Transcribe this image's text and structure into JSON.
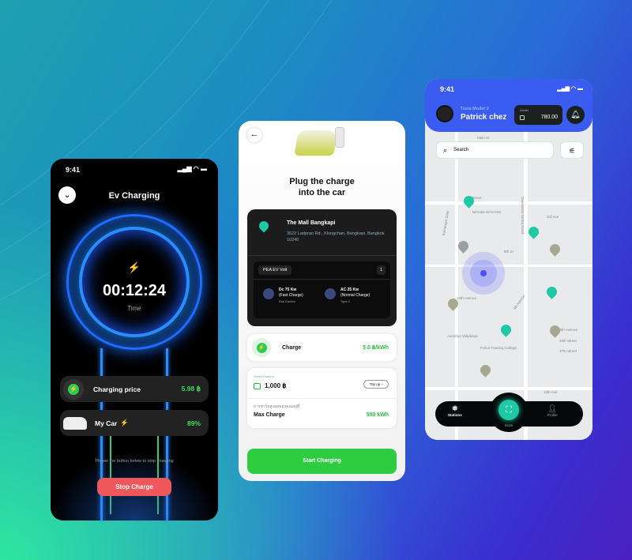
{
  "screen1": {
    "time": "9:41",
    "title": "Ev Charging",
    "timer": "00:12:24",
    "timer_label": "Time",
    "price_label": "Charging price",
    "price_value": "5.98 ฿",
    "car_label": "My Car",
    "car_value": "89%",
    "hint": "Please the button below to stop charging",
    "stop_button": "Stop Charge"
  },
  "screen2": {
    "title_line1": "Plug the charge",
    "title_line2": "into the car",
    "station": {
      "name": "The Mall Bangkapi",
      "address": "3522 Ladprao Rd., Klongchan, Bangkapi, Bangkok 10240",
      "provider": "PEA EV Volt",
      "count": "1",
      "connectors": [
        {
          "title": "Dc 75 Kw",
          "subtitle": "(Fast Charge)",
          "type": "Css Combo"
        },
        {
          "title": "AC 25 Kw",
          "subtitle": "(Normal Charge)",
          "type": "Type 2"
        }
      ]
    },
    "charge_label": "Charge",
    "charge_value": "5.0 ฿/kWh",
    "wallet_label": "Wallet Balance",
    "wallet_value": "1,000 ฿",
    "topup": "Top up",
    "max_thai": "การชาร์จสูงสุดของคุณอยู่ที่",
    "max_label": "Max Charge",
    "max_value": "500 kWh",
    "start_button": "Start Charging"
  },
  "screen3": {
    "time": "9:41",
    "car_model": "Tesla Model 3",
    "user_name": "Patrick chez",
    "wallet_label": "Wallet",
    "wallet_value": "780.00",
    "search_placeholder": "Search",
    "streets": [
      "Main St",
      "5th Street",
      "3rd Ave",
      "8th St",
      "10th Avenue",
      "4th Avenue",
      "45th Avenue",
      "46th Street",
      "47th Street",
      "10th Ave",
      "Jawaharlal Nehru Road",
      "Kamarajar Salai",
      "Nirmala Girls HSS",
      "Aandriya Vidyalaya",
      "Police Training College"
    ],
    "nav": {
      "stations": "Stations",
      "scan": "Scan",
      "profile": "Profile"
    }
  },
  "colors": {
    "green": "#3ddc5a",
    "red": "#f0575b",
    "blue": "#3b5cf0",
    "teal": "#1fc9a5"
  }
}
